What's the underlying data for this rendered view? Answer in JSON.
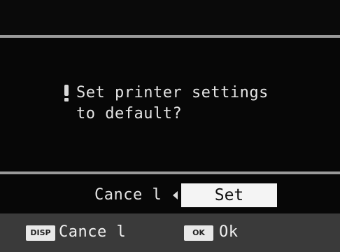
{
  "dialog": {
    "message_line1": "Set printer settings",
    "message_line2": "to default?",
    "warning_icon": "exclamation-icon"
  },
  "choices": {
    "cancel_label": "Cance l",
    "set_label": "Set",
    "selected": "Set",
    "selector_icon": "left-arrow-icon"
  },
  "bottom_bar": {
    "disp_key": "DISP",
    "disp_action": "Cance l",
    "ok_key": "OK",
    "ok_action": "Ok"
  },
  "colors": {
    "background": "#070707",
    "divider": "#9a9a9a",
    "selected_bg": "#f4f4f4",
    "bottom_bar": "#3a3a3a"
  }
}
